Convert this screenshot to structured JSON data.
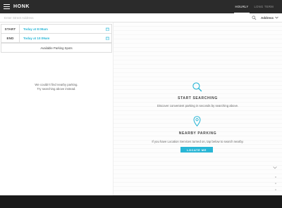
{
  "topbar": {
    "brand": "HONK",
    "menu_icon": "hamburger-menu-icon",
    "tabs": [
      {
        "label": "HOURLY",
        "active": true
      },
      {
        "label": "LONG TERM",
        "active": false
      }
    ]
  },
  "search": {
    "placeholder": "Enter Street Address",
    "icon": "search-icon",
    "sort_label": "Address",
    "sort_icon": "chevron-down-icon"
  },
  "booking": {
    "start_label": "START",
    "start_value": "Today at 8:09am",
    "end_label": "END",
    "end_value": "Today at 10:09am",
    "spots_label": "Available Parking Spots"
  },
  "left_empty": {
    "line1": "We couldn't find nearby parking.",
    "line2": "Try searching above instead."
  },
  "main": {
    "search_heading": "START SEARCHING",
    "search_desc": "Discover convenient parking in seconds by searching above.",
    "nearby_heading": "NEARBY PARKING",
    "nearby_desc": "If you have Location Services turned on, tap below to search nearby.",
    "locate_button": "LOCATE ME"
  },
  "colors": {
    "accent": "#29b6d6",
    "nav_bg": "#2b2b2b",
    "bottom_bg": "#1a1a1a"
  }
}
